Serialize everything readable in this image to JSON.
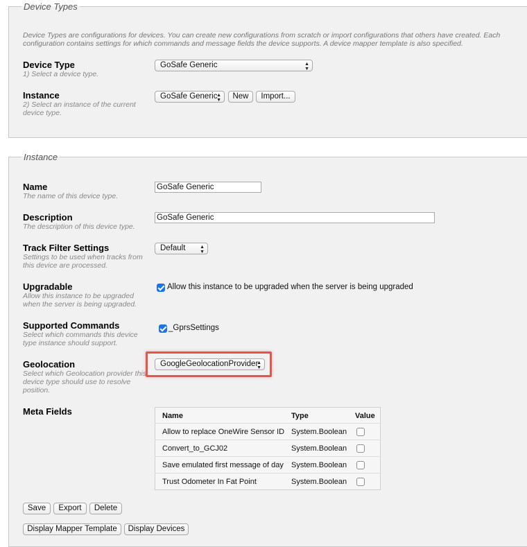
{
  "device_types": {
    "legend": "Device Types",
    "intro": "Device Types are configurations for devices. You can create new configurations from scratch or import configurations that others have created. Each configuration contains settings for which commands and message fields the device supports. A device mapper template is also specified.",
    "device_type": {
      "label": "Device Type",
      "hint": "1) Select a device type.",
      "selected": "GoSafe Generic"
    },
    "instance": {
      "label": "Instance",
      "hint": "2) Select an instance of the current device type.",
      "selected": "GoSafe Generic",
      "new_label": "New",
      "import_label": "Import..."
    }
  },
  "instance": {
    "legend": "Instance",
    "name": {
      "label": "Name",
      "hint": "The name of this device type.",
      "value": "GoSafe Generic"
    },
    "description": {
      "label": "Description",
      "hint": "The description of this device type.",
      "value": "GoSafe Generic"
    },
    "track_filter": {
      "label": "Track Filter Settings",
      "hint": "Settings to be used when tracks from this device are processed.",
      "selected": "Default"
    },
    "upgradable": {
      "label": "Upgradable",
      "hint": "Allow this instance to be upgraded when the server is being upgraded.",
      "checkbox_label": "Allow this instance to be upgraded when the server is being upgraded",
      "checked": true
    },
    "supported_commands": {
      "label": "Supported Commands",
      "hint": "Select which commands this device type instance should support.",
      "items": [
        {
          "label": "_GprsSettings",
          "checked": true
        }
      ]
    },
    "geolocation": {
      "label": "Geolocation",
      "hint": "Select which Geolocation provider this device type should use to resolve position.",
      "selected": "GoogleGeolocationProvider",
      "highlight_color": "#e2574c"
    },
    "meta_fields": {
      "label": "Meta Fields",
      "columns": [
        "Name",
        "Type",
        "Value"
      ],
      "rows": [
        {
          "name": "Allow to replace OneWire Sensor ID",
          "type": "System.Boolean",
          "checked": false
        },
        {
          "name": "Convert_to_GCJ02",
          "type": "System.Boolean",
          "checked": false
        },
        {
          "name": "Save emulated first message of day",
          "type": "System.Boolean",
          "checked": false
        },
        {
          "name": "Trust Odometer In Fat Point",
          "type": "System.Boolean",
          "checked": false
        }
      ]
    },
    "buttons": {
      "save": "Save",
      "export": "Export",
      "delete": "Delete",
      "display_mapper_template": "Display Mapper Template",
      "display_devices": "Display Devices"
    }
  },
  "colors": {
    "panel_bg": "#f1f1f1",
    "checkbox_checked": "#1b74e8"
  },
  "icons": {
    "select_arrows": "up-down-chevron-icon",
    "checkmark": "checkmark-icon"
  }
}
